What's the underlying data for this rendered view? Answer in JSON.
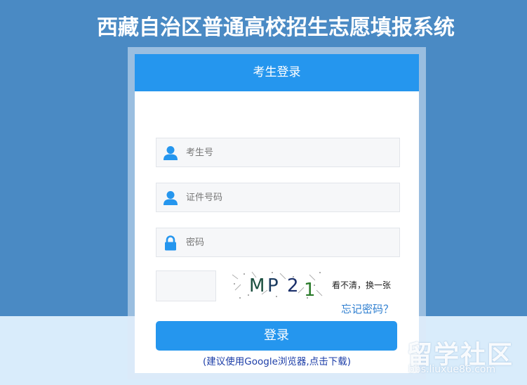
{
  "header": {
    "title": "西藏自治区普通高校招生志愿填报系统"
  },
  "login_card": {
    "title": "考生登录",
    "fields": [
      {
        "placeholder": "考生号",
        "icon": "user-icon"
      },
      {
        "placeholder": "证件号码",
        "icon": "user-icon"
      },
      {
        "placeholder": "密码",
        "icon": "lock-icon"
      }
    ],
    "captcha": {
      "input_value": "",
      "image_text": "MP 2 1",
      "chars": [
        "M",
        "P",
        "2",
        "1"
      ],
      "refresh_label": "看不清，换一张"
    },
    "forgot_password": "忘记密码？",
    "login_button": "登录",
    "browser_tip": "(建议使用Google浏览器,点击下载)"
  },
  "watermark": {
    "logo_text": "留学社区",
    "url": "bbs.liuxue86.com"
  },
  "colors": {
    "background": "#4a8ac4",
    "accent": "#2596ee",
    "bottom_band": "#d9ecfb",
    "link": "#2f7fd0",
    "tip": "#1d3ea8"
  }
}
